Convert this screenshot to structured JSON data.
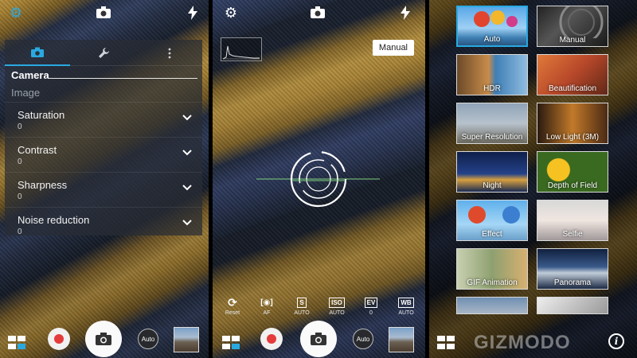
{
  "panel1": {
    "tabs": [
      {
        "name": "camera",
        "icon": "camera-icon"
      },
      {
        "name": "tools",
        "icon": "wrench-icon"
      },
      {
        "name": "more",
        "icon": "more-vertical-icon"
      }
    ],
    "section_camera": "Camera",
    "section_image": "Image",
    "rows": [
      {
        "label": "Saturation",
        "value": "0"
      },
      {
        "label": "Contrast",
        "value": "0"
      },
      {
        "label": "Sharpness",
        "value": "0"
      },
      {
        "label": "Noise reduction",
        "value": "0"
      }
    ],
    "mode_label": "Auto"
  },
  "panel2": {
    "manual_label": "Manual",
    "mode_label": "Auto",
    "controls": [
      {
        "symbol": "⟳",
        "caption": "Reset"
      },
      {
        "symbol": "[◉]",
        "caption": "AF"
      },
      {
        "symbol": "S",
        "caption": "AUTO"
      },
      {
        "symbol": "ISO",
        "caption": "AUTO"
      },
      {
        "symbol": "EV",
        "caption": "0"
      },
      {
        "symbol": "WB",
        "caption": "AUTO"
      }
    ]
  },
  "panel3": {
    "modes": [
      {
        "name": "Auto"
      },
      {
        "name": "Manual"
      },
      {
        "name": "HDR"
      },
      {
        "name": "Beautification"
      },
      {
        "name": "Super Resolution"
      },
      {
        "name": "Low Light (3M)"
      },
      {
        "name": "Night"
      },
      {
        "name": "Depth of Field"
      },
      {
        "name": "Effect"
      },
      {
        "name": "Selfie"
      },
      {
        "name": "GIF Animation"
      },
      {
        "name": "Panorama"
      }
    ],
    "watermark": "GIZMODO",
    "info_glyph": "i"
  },
  "colors": {
    "accent": "#29a9e1",
    "record": "#e43b3b"
  }
}
